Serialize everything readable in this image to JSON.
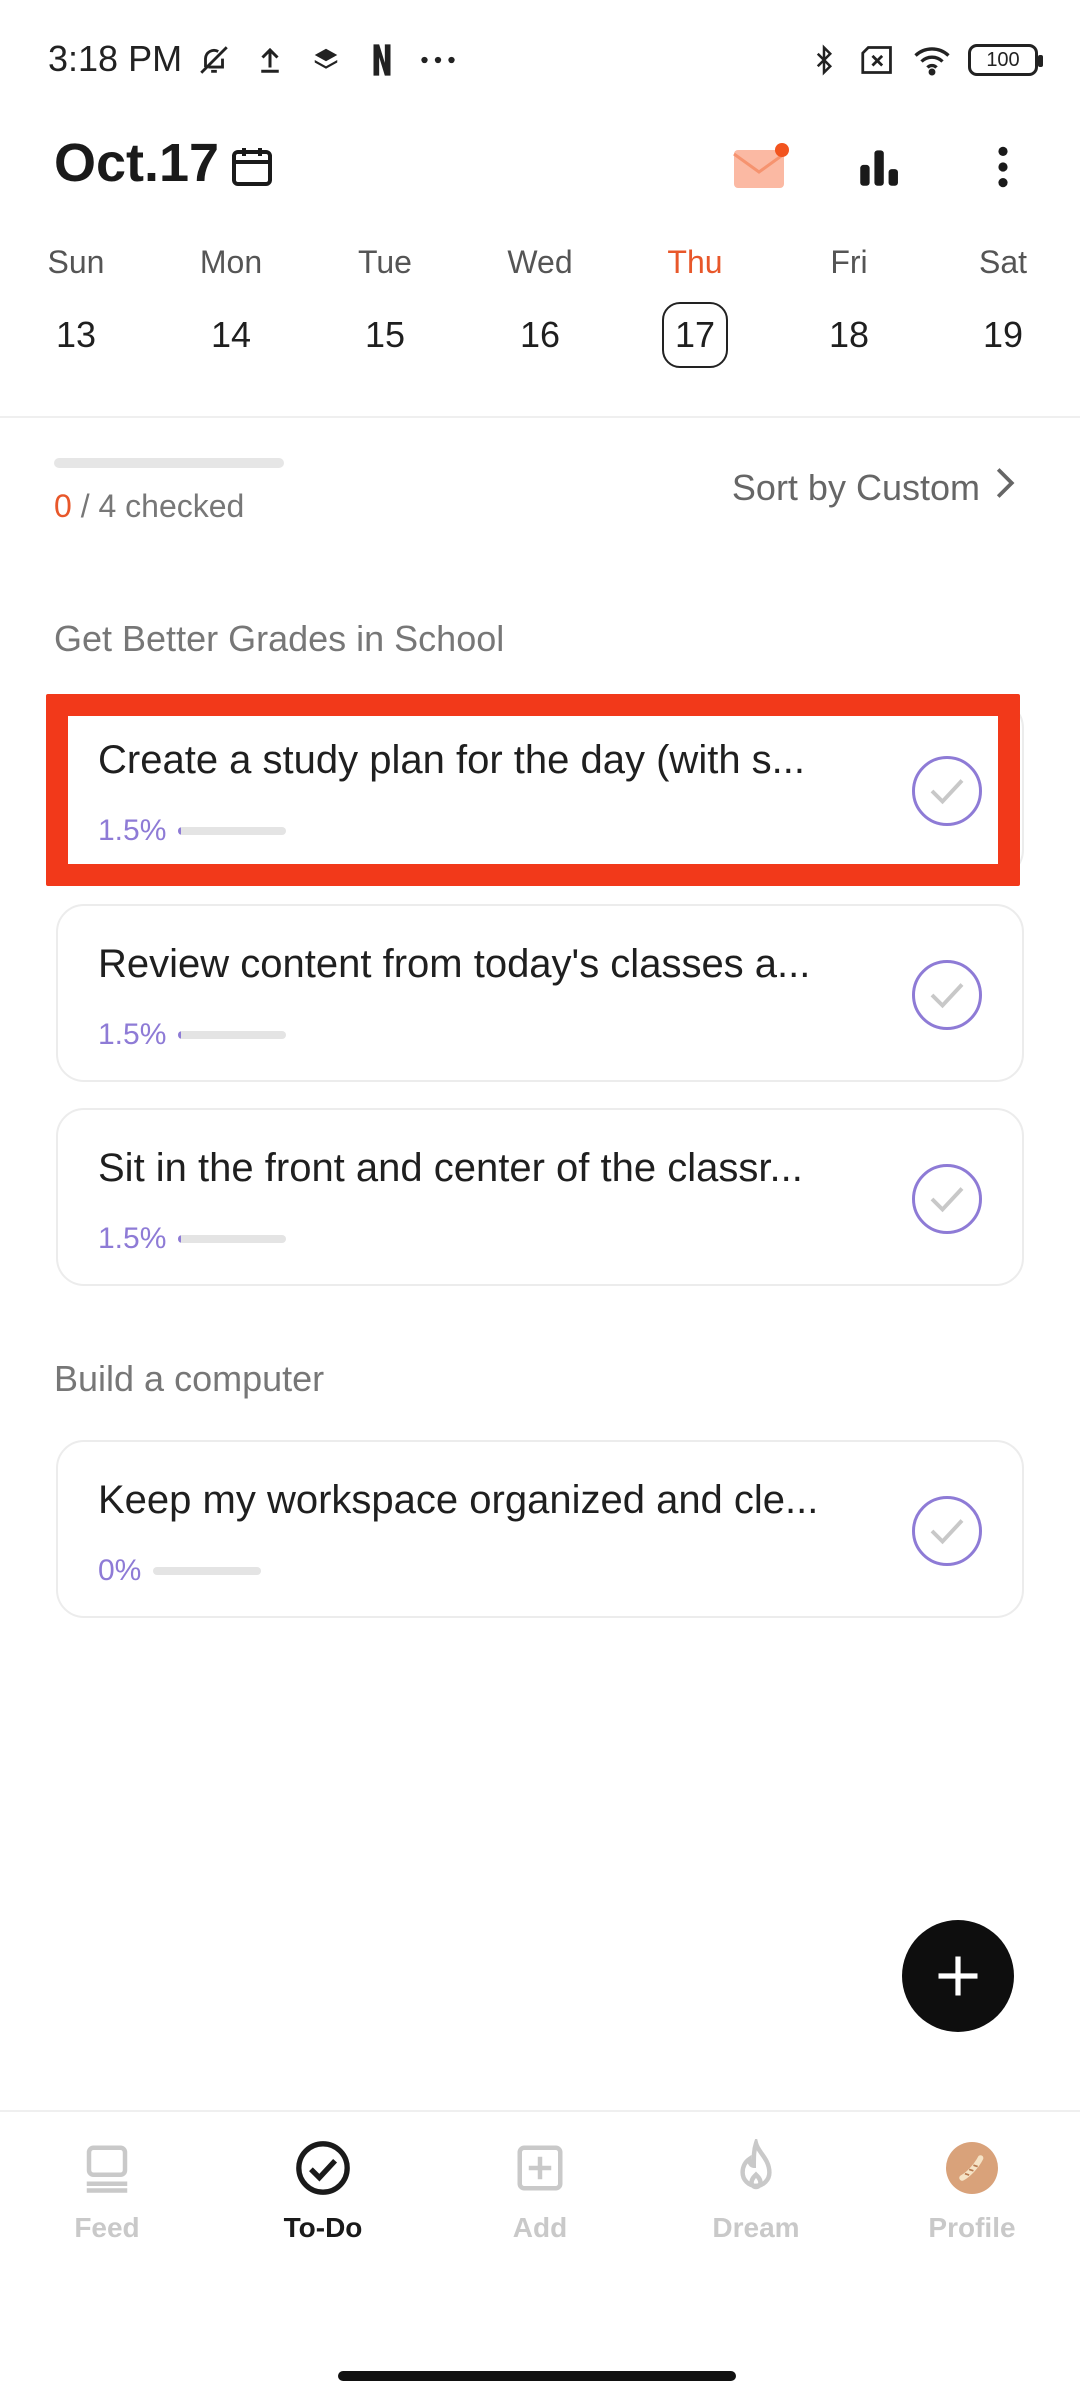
{
  "status_bar": {
    "time": "3:18 PM",
    "left_icons": [
      "bell-off-icon",
      "upload-icon",
      "layers-icon",
      "netflix-icon",
      "more-dots-icon"
    ],
    "right_icons": [
      "bluetooth-icon",
      "no-sim-icon",
      "wifi-icon"
    ],
    "battery": "100"
  },
  "header": {
    "date": "Oct.17",
    "accent_color": "#e8572a"
  },
  "week": [
    {
      "name": "Sun",
      "num": "13"
    },
    {
      "name": "Mon",
      "num": "14"
    },
    {
      "name": "Tue",
      "num": "15"
    },
    {
      "name": "Wed",
      "num": "16"
    },
    {
      "name": "Thu",
      "num": "17",
      "active": true
    },
    {
      "name": "Fri",
      "num": "18"
    },
    {
      "name": "Sat",
      "num": "19"
    }
  ],
  "summary": {
    "checked": "0",
    "total_text": " / 4 checked",
    "progress": 0
  },
  "sort": {
    "label": "Sort by Custom"
  },
  "sections": [
    {
      "title": "Get Better Grades in School",
      "tasks": [
        {
          "title": "Create a study plan for the day (with s...",
          "percent_label": "1.5%",
          "progress": 0.015
        },
        {
          "title": "Review content from today's classes a...",
          "percent_label": "1.5%",
          "progress": 0.015
        },
        {
          "title": "Sit in the front and center of the classr...",
          "percent_label": "1.5%",
          "progress": 0.015
        }
      ]
    },
    {
      "title": "Build a computer",
      "tasks": [
        {
          "title": "Keep my workspace organized and cle...",
          "percent_label": "0%",
          "progress": 0
        }
      ]
    }
  ],
  "nav": [
    {
      "label": "Feed",
      "icon": "feed-icon"
    },
    {
      "label": "To-Do",
      "icon": "check-circle-icon",
      "active": true
    },
    {
      "label": "Add",
      "icon": "add-square-icon"
    },
    {
      "label": "Dream",
      "icon": "flame-icon"
    },
    {
      "label": "Profile",
      "icon": "avatar"
    }
  ],
  "colors": {
    "accent": "#e8572a",
    "progress": "#8e7bd6",
    "highlight": "#f2391a"
  }
}
